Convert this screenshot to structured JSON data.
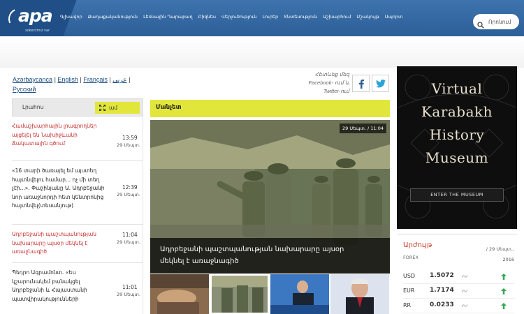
{
  "header": {
    "logo": "apa",
    "logo_sub": "sokentmız var",
    "nav": [
      "Գլխավոր",
      "Քաղաքականություն",
      "Լեռնային Ղարաբաղ",
      "Բիզնես",
      "Վերլուծություն",
      "Լուրեր",
      "Տնտեսություն",
      "Աշխարհում",
      "Մշակույթ",
      "Սպորտ"
    ],
    "search_label": "Որոնում"
  },
  "languages": {
    "items": [
      "Azərbaycanca",
      "English",
      "Français",
      "عربي",
      "Русский"
    ],
    "separator": "|"
  },
  "social": {
    "text": "Հետևեք մեզ Facebook- ում և Twitter-ում",
    "facebook_icon": "facebook-icon",
    "twitter_icon": "twitter-icon"
  },
  "left_tabs": {
    "tab1": "Լրահոս",
    "tab2": "ամ"
  },
  "news": [
    {
      "title": "Համաշխարհային լրագրողներ այցելել են Նախիջևանի Ճակատային գծում",
      "time": "13:59",
      "date": "29 Սեպտ.",
      "color": "red"
    },
    {
      "title": "«16 տարի ծառայել եմ այստեղ հայտնվելու համար... ոչ մի տեղ չէի...». Փաշինյանը Ա. Ադրբեջանի նոր առաջնորդի հետ կենտրոնից հայտնվել(տեսանյութ)",
      "time": "12:39",
      "date": "29 Սեպտ.",
      "color": "dark"
    },
    {
      "title": "Ադրբեջանի պաշտպանության նախարարը այսօր մեկնել է առաջնագիծ",
      "time": "11:04",
      "date": "29 Սեպտ.",
      "color": "red"
    },
    {
      "title": "Պեդրո Ագրամոնտ. «Ես կշարունակեմ բանակցել Ադրբեջանի և Հայաստանի պատվիրակությունների",
      "time": "11:01",
      "date": "29 Սեպտ.",
      "color": "dark"
    }
  ],
  "main": {
    "section_title": "Մանչետ",
    "hero_date": "29 Սեպտ. / 11:04",
    "hero_caption": "Ադրբեջանի պաշտպանության նախարարը այսօր մեկնել է առաջնագիծ"
  },
  "ad": {
    "line1": "Virtual",
    "line2": "Karabakh",
    "line3": "History",
    "line4": "Museum",
    "button": "ENTER THE MUSEUM"
  },
  "rates": {
    "title": "Արժույթ",
    "sub": "FOREX",
    "date_line1": "/ 29 Սեպտ.,",
    "date_line2": "2016",
    "rows": [
      {
        "code": "USD",
        "value": "1.5072",
        "trend": "up"
      },
      {
        "code": "EUR",
        "value": "1.7174",
        "trend": "up"
      },
      {
        "code": "RR",
        "value": "0.0233",
        "trend": "up"
      }
    ]
  },
  "colors": {
    "header": "#2d5f98",
    "accent": "#e2e63a",
    "news_red": "#c63131",
    "rates_title": "#c73a28"
  }
}
